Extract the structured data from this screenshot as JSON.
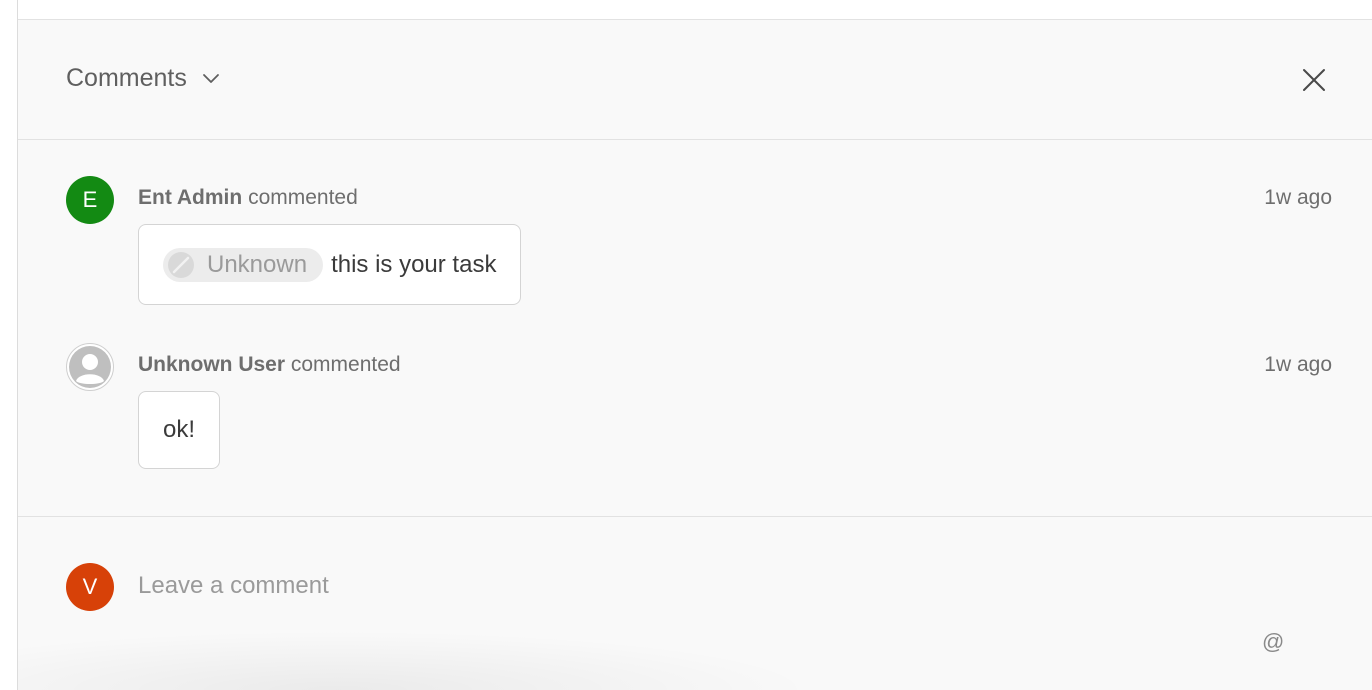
{
  "header": {
    "title": "Comments"
  },
  "comments": [
    {
      "avatar_initial": "E",
      "author": "Ent Admin",
      "action": "commented",
      "time": "1w ago",
      "mention": "Unknown",
      "text": "this is your task"
    },
    {
      "author": "Unknown User",
      "action": "commented",
      "time": "1w ago",
      "text": "ok!"
    }
  ],
  "composer": {
    "avatar_initial": "V",
    "placeholder": "Leave a comment",
    "mention_symbol": "@"
  },
  "colors": {
    "avatar_green": "#138a13",
    "avatar_orange": "#d74108",
    "panel_bg": "#f9f9f9"
  },
  "icons": {
    "header_toggle": "chevron-down-icon",
    "close": "close-icon",
    "mention_avatar": "unknown-user-icon",
    "default_avatar": "person-icon"
  }
}
